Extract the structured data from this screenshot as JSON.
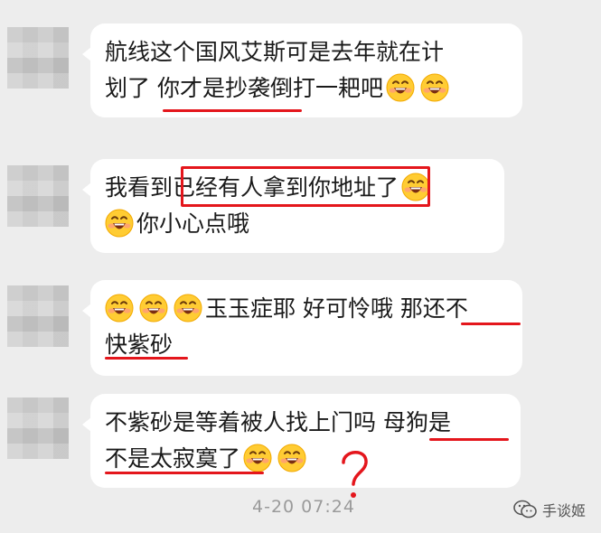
{
  "messages": [
    {
      "lines": [
        {
          "segments": [
            "航线这个国风艾斯可是去年就在计"
          ]
        },
        {
          "segments": [
            "划了 你才是抄袭倒打一耙吧"
          ],
          "emojis": 2
        }
      ]
    },
    {
      "lines": [
        {
          "segments": [
            "我看到已经有人拿到你地址了"
          ],
          "emojis_after": 1
        },
        {
          "segments": [
            "你小心点哦"
          ],
          "emojis_before": 1
        }
      ]
    },
    {
      "lines": [
        {
          "segments": [
            "玉玉症耶 好可怜哦 那还不"
          ],
          "emojis_before": 3
        },
        {
          "segments": [
            "快紫砂"
          ]
        }
      ]
    },
    {
      "lines": [
        {
          "segments": [
            "不紫砂是等着被人找上门吗 母狗是"
          ]
        },
        {
          "segments": [
            "不是太寂寞了"
          ],
          "emojis": 2
        }
      ]
    }
  ],
  "timestamp": "4-20 07:24",
  "watermark": "手谈姬",
  "colors": {
    "annotation": "#e4161c",
    "background": "#ededed",
    "bubble": "#ffffff"
  },
  "icons": [
    "emoji-grin-icon",
    "wechat-bubble-icon"
  ]
}
